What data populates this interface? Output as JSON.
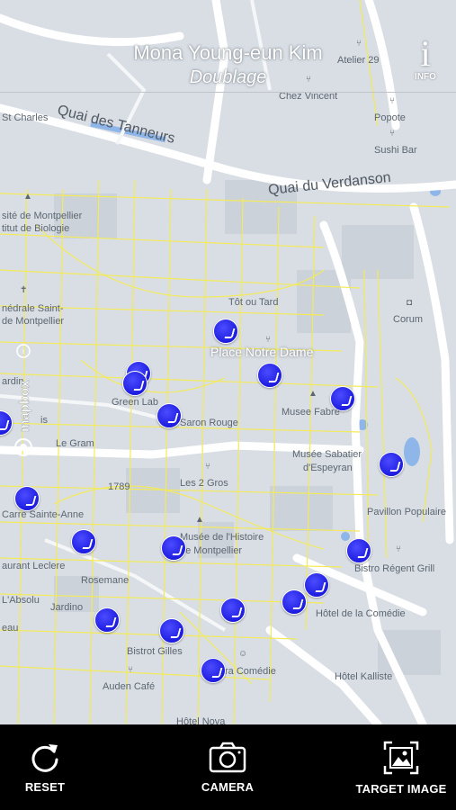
{
  "header": {
    "title": "Mona Young-eun Kim",
    "subtitle": "Doublage",
    "info_label": "INFO"
  },
  "map": {
    "attribution": "mapbox",
    "highlight_label": "Place Notre Dame",
    "streets": [
      "Quai des Tanneurs",
      "Quai du Verdanson"
    ],
    "places": [
      "Atelier 29",
      "Chez Vincent",
      "Popote",
      "Sushi Bar",
      "St Charles",
      "sité de Montpellier",
      "titut de Biologie",
      "nédrale Saint-",
      "de Montpellier",
      "Tôt ou Tard",
      "Corum",
      "ardin",
      "Green Lab",
      "Saron Rouge",
      "Musee Fabre",
      "is",
      "Le Gram",
      "Musée Sabatier",
      "d'Espeyran",
      "1789",
      "Les 2 Gros",
      "Carre Sainte-Anne",
      "Pavillon Populaire",
      "Musée de l'Histoire",
      "de Montpellier",
      "aurant Leclere",
      "Rosemane",
      "Bistro Régent Grill",
      "L'Absolu",
      "Jardino",
      "Hôtel de la Comédie",
      "eau",
      "Bistrot Gilles",
      "ra Comédie",
      "Auden Café",
      "Hôtel Kalliste",
      "Hôtel Nova"
    ]
  },
  "toolbar": {
    "reset_label": "RESET",
    "camera_label": "CAMERA",
    "target_label": "TARGET IMAGE"
  },
  "colors": {
    "map_bg": "#d9dee5",
    "roads_major": "#ffffff",
    "roads_minor": "#f2ea5a",
    "marker": "#1d1ce0",
    "toolbar_bg": "#000000"
  }
}
